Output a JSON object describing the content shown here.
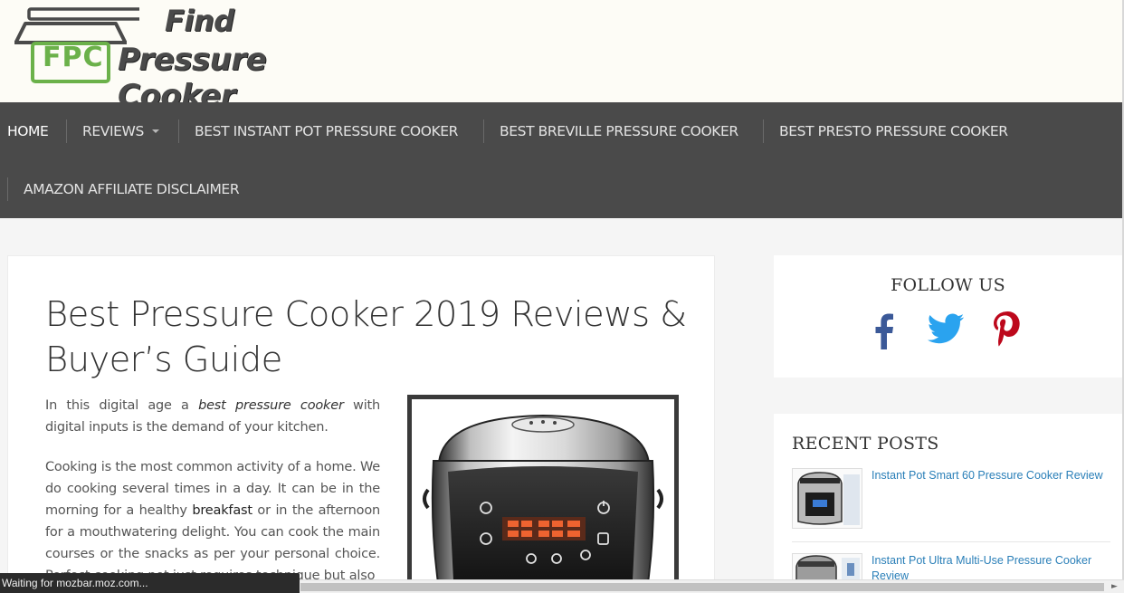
{
  "header": {
    "logo_monogram": "FPC",
    "logo_line1": "Find",
    "logo_line2": "Pressure Cooker"
  },
  "nav": {
    "home": "HOME",
    "reviews": "REVIEWS",
    "best_instant_pot": "BEST INSTANT POT PRESSURE COOKER",
    "best_breville": "BEST BREVILLE PRESSURE COOKER",
    "best_presto": "BEST PRESTO PRESSURE COOKER",
    "disclaimer": "AMAZON AFFILIATE DISCLAIMER"
  },
  "article": {
    "title": "Best Pressure Cooker 2019 Reviews & Buyer’s Guide",
    "p1_before": "In this digital age a ",
    "p1_em": "best pressure cooker",
    "p1_after": " with digital inputs is the demand of your kitchen.",
    "p2_before": "Cooking is the most common activity of a home. We do cooking several times in a day. It can be in the morning for a healthy ",
    "p2_bold": "breakfast",
    "p2_after": " or in the afternoon for a mouthwatering delight. You can cook the main courses or the snacks as per your personal choice. Perfect cooking pot just requires technique but also"
  },
  "sidebar": {
    "follow_title": "FOLLOW US",
    "recent_title": "RECENT POSTS",
    "posts": [
      {
        "title": "Instant Pot Smart 60 Pressure Cooker Review"
      },
      {
        "title": "Instant Pot Ultra Multi-Use Pressure Cooker Review"
      }
    ]
  },
  "browser": {
    "status": "Waiting for mozbar.moz.com..."
  },
  "colors": {
    "nav_bg": "#4a4a4a",
    "logo_green": "#6bb14a",
    "link_blue": "#2a7fb8",
    "facebook": "#3b5998",
    "twitter": "#1da1f2",
    "pinterest": "#bd081c"
  },
  "icons": [
    "facebook-icon",
    "twitter-icon",
    "pinterest-icon",
    "chevron-down-icon"
  ]
}
